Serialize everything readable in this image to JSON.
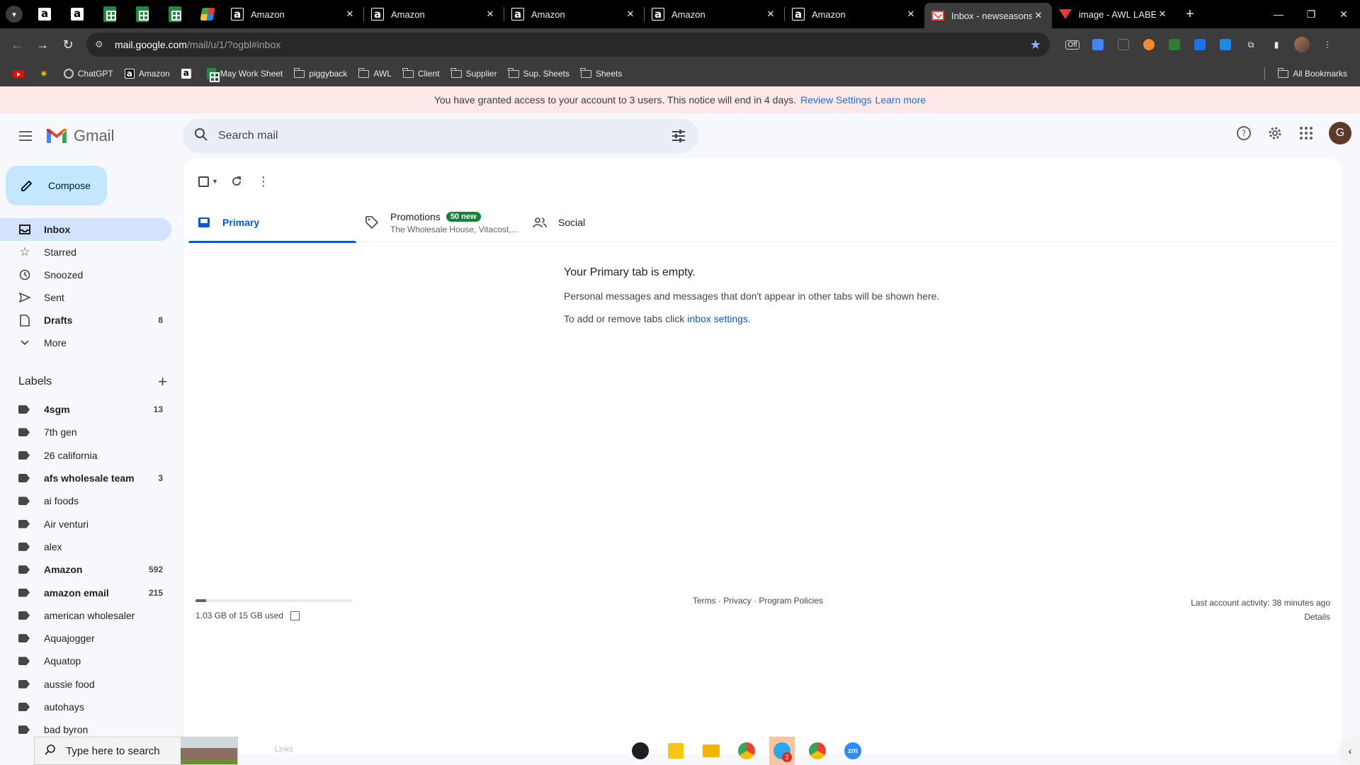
{
  "browser": {
    "tabs": [
      {
        "title": "Amazon",
        "icon": "amazon-icon",
        "active": false
      },
      {
        "title": "Amazon",
        "icon": "amazon-icon",
        "active": false
      },
      {
        "title": "Amazon",
        "icon": "amazon-icon",
        "active": false
      },
      {
        "title": "Amazon",
        "icon": "amazon-icon",
        "active": false
      },
      {
        "title": "Amazon",
        "icon": "amazon-icon",
        "active": false
      },
      {
        "title": "Inbox - newseasonsgd",
        "icon": "gmail-icon",
        "active": true
      },
      {
        "title": "image - AWL LABEL",
        "icon": "awl-icon",
        "active": false
      }
    ],
    "url_host": "mail.google.com",
    "url_path": "/mail/u/1/?ogbl#inbox",
    "bookmarks": [
      {
        "label": "",
        "icon": "youtube-icon"
      },
      {
        "label": "",
        "icon": "extension-icon"
      },
      {
        "label": "ChatGPT",
        "icon": "chatgpt-icon"
      },
      {
        "label": "Amazon",
        "icon": "amazon-icon"
      },
      {
        "label": "",
        "icon": "amazon-icon"
      },
      {
        "label": "May Work Sheet",
        "icon": "sheets-icon"
      },
      {
        "label": "piggyback",
        "icon": "folder-icon"
      },
      {
        "label": "AWL",
        "icon": "folder-icon"
      },
      {
        "label": "Client",
        "icon": "folder-icon"
      },
      {
        "label": "Supplier",
        "icon": "folder-icon"
      },
      {
        "label": "Sup. Sheets",
        "icon": "folder-icon"
      },
      {
        "label": "Sheets",
        "icon": "folder-icon"
      }
    ],
    "all_bookmarks": "All Bookmarks",
    "ext_off_label": "Off"
  },
  "notice": {
    "text": "You have granted access to your account to 3 users. This notice will end in 4 days.",
    "review": "Review Settings",
    "learn": "Learn more"
  },
  "gmail": {
    "brand": "Gmail",
    "search_placeholder": "Search mail",
    "avatar_letter": "G",
    "compose": "Compose",
    "nav": [
      {
        "label": "Inbox",
        "count": "",
        "icon": "inbox-icon",
        "active": true,
        "bold": true
      },
      {
        "label": "Starred",
        "count": "",
        "icon": "star-icon",
        "active": false,
        "bold": false
      },
      {
        "label": "Snoozed",
        "count": "",
        "icon": "clock-icon",
        "active": false,
        "bold": false
      },
      {
        "label": "Sent",
        "count": "",
        "icon": "send-icon",
        "active": false,
        "bold": false
      },
      {
        "label": "Drafts",
        "count": "8",
        "icon": "draft-icon",
        "active": false,
        "bold": true
      },
      {
        "label": "More",
        "count": "",
        "icon": "chevron-down-icon",
        "active": false,
        "bold": false
      }
    ],
    "labels_heading": "Labels",
    "labels": [
      {
        "label": "4sgm",
        "count": "13",
        "bold": true
      },
      {
        "label": "7th gen",
        "count": "",
        "bold": false
      },
      {
        "label": "26 california",
        "count": "",
        "bold": false
      },
      {
        "label": "afs wholesale team",
        "count": "3",
        "bold": true
      },
      {
        "label": "ai foods",
        "count": "",
        "bold": false
      },
      {
        "label": "Air venturi",
        "count": "",
        "bold": false
      },
      {
        "label": "alex",
        "count": "",
        "bold": false
      },
      {
        "label": "Amazon",
        "count": "592",
        "bold": true
      },
      {
        "label": "amazon email",
        "count": "215",
        "bold": true
      },
      {
        "label": "american wholesaler",
        "count": "",
        "bold": false
      },
      {
        "label": "Aquajogger",
        "count": "",
        "bold": false
      },
      {
        "label": "Aquatop",
        "count": "",
        "bold": false
      },
      {
        "label": "aussie food",
        "count": "",
        "bold": false
      },
      {
        "label": "autohays",
        "count": "",
        "bold": false
      },
      {
        "label": "bad byron",
        "count": "",
        "bold": false
      }
    ],
    "tabs": {
      "primary": "Primary",
      "promotions": "Promotions",
      "promotions_badge": "50 new",
      "promotions_snippet": "The Wholesale House, Vitacost,...",
      "social": "Social"
    },
    "empty": {
      "title": "Your Primary tab is empty.",
      "line1": "Personal messages and messages that don't appear in other tabs will be shown here.",
      "line2_prefix": "To add or remove tabs click",
      "line2_link": "inbox settings",
      "line2_suffix": "."
    },
    "storage": {
      "text": "1.03 GB of 15 GB used",
      "used_fraction": 0.069
    },
    "footer_links": "Terms · Privacy · Program Policies",
    "last_activity": "Last account activity: 38 minutes ago",
    "details": "Details"
  },
  "taskbar": {
    "search_placeholder": "Type here to search",
    "links_label": "Links",
    "telegram_badge": "2",
    "zoom_label": "zm"
  }
}
